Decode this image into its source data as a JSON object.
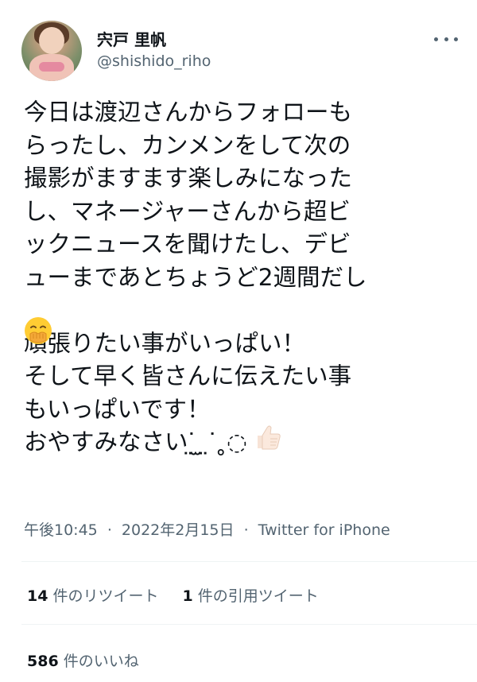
{
  "user": {
    "display_name": "宍戸 里帆",
    "handle": "@shishido_riho"
  },
  "tweet": {
    "text": "今日は渡辺さんからフォローも\nらったし、カンメンをして次の\n撮影がますます楽しみになった\nし、マネージャーさんから超ビ\nックニュースを聞けたし、デビ\nューまであとちょうど2週間だし\n \n頑張りたい事がいっぱい！\nそして早く皆さんに伝えたい事\nもいっぱいです！\nおやすみなさいᐝ̤ ̫ ̤ᐝ˳◌",
    "emoji_1": "face-with-hand-over-mouth",
    "emoji_2": "thumbs-up"
  },
  "meta": {
    "time": "午後10:45",
    "separator": "·",
    "date": "2022年2月15日",
    "source": "Twitter for iPhone"
  },
  "stats": {
    "retweets_count": "14",
    "retweets_label": " 件のリツイート",
    "quotes_count": "1",
    "quotes_label": " 件の引用ツイート",
    "likes_count": "586",
    "likes_label": " 件のいいね"
  },
  "colors": {
    "text_primary": "#0f1419",
    "text_secondary": "#536471",
    "divider": "#eff3f4"
  }
}
